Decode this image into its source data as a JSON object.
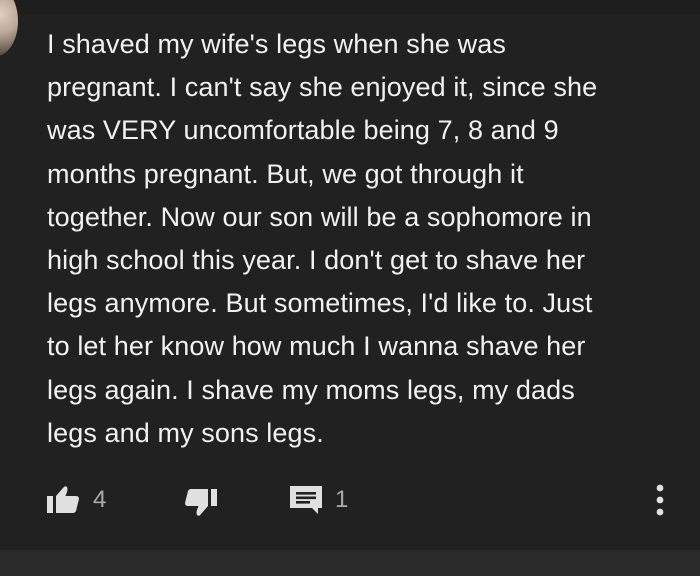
{
  "comment": {
    "avatar_icon": "user-avatar",
    "text": "I shaved my wife's legs when she was\npregnant.  I can't say she enjoyed it, since she\nwas VERY uncomfortable being 7, 8 and 9\nmonths pregnant.  But, we got through it\ntogether.  Now our son will be a sophomore in\nhigh school this year.  I don't get to shave her\nlegs anymore.  But sometimes, I'd like to.  Just\nto let her know how much I wanna shave her\nlegs again.  I shave my moms legs, my dads\nlegs and my sons legs.",
    "like_count": "4",
    "reply_count": "1"
  },
  "icons": {
    "like": "thumbs-up-icon",
    "dislike": "thumbs-down-icon",
    "reply": "reply-comment-icon",
    "more": "more-vertical-icon"
  },
  "colors": {
    "background": "#212121",
    "text": "#f1f1f1",
    "secondary_text": "#aaaaaa",
    "icon": "#e0e0e0"
  }
}
